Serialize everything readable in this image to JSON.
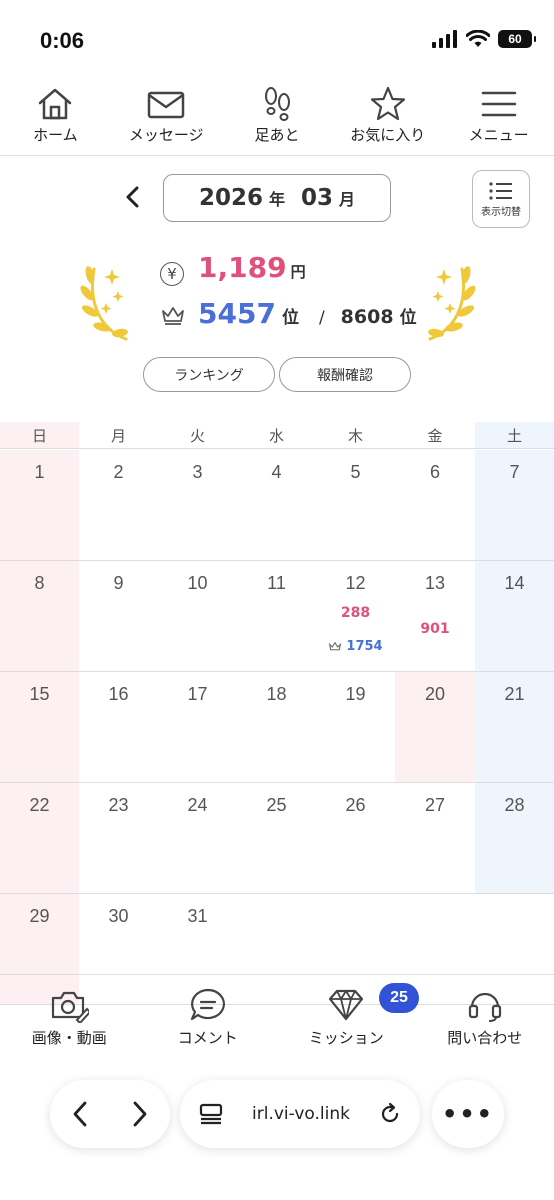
{
  "status": {
    "time": "0:06",
    "battery": "60"
  },
  "topnav": [
    {
      "label": "ホーム",
      "icon": "home-icon"
    },
    {
      "label": "メッセージ",
      "icon": "mail-icon"
    },
    {
      "label": "足あと",
      "icon": "footprints-icon"
    },
    {
      "label": "お気に入り",
      "icon": "star-icon"
    },
    {
      "label": "メニュー",
      "icon": "hamburger-icon"
    }
  ],
  "month": {
    "year": "2026",
    "year_unit": "年",
    "month": "03",
    "month_unit": "月",
    "view_toggle": "表示切替"
  },
  "stats": {
    "yen_symbol": "¥",
    "amount": "1,189",
    "amount_unit": "円",
    "rank": "5457",
    "rank_unit": "位",
    "slash": "/",
    "total": "8608",
    "total_unit": "位"
  },
  "buttons": {
    "ranking": "ランキング",
    "reward": "報酬確認"
  },
  "calendar": {
    "weekdays": [
      "日",
      "月",
      "火",
      "水",
      "木",
      "金",
      "土"
    ],
    "weeks": [
      [
        "1",
        "2",
        "3",
        "4",
        "5",
        "6",
        "7"
      ],
      [
        "8",
        "9",
        "10",
        "11",
        "12",
        "13",
        "14"
      ],
      [
        "15",
        "16",
        "17",
        "18",
        "19",
        "20",
        "21"
      ],
      [
        "22",
        "23",
        "24",
        "25",
        "26",
        "27",
        "28"
      ],
      [
        "29",
        "30",
        "31",
        "",
        "",
        "",
        ""
      ]
    ],
    "entries": {
      "12": {
        "earn": "288",
        "rank": "1754"
      },
      "13": {
        "earn": "901"
      }
    }
  },
  "tabbar": [
    {
      "label": "画像・動画",
      "icon": "camera-edit-icon"
    },
    {
      "label": "コメント",
      "icon": "comment-icon"
    },
    {
      "label": "ミッション",
      "icon": "diamond-icon",
      "badge": "25"
    },
    {
      "label": "問い合わせ",
      "icon": "headset-icon"
    }
  ],
  "browser": {
    "url": "irl.vi-vo.link",
    "more": "•••"
  },
  "colors": {
    "pink": "#e0507a",
    "blue": "#4a6fd8",
    "badge": "#3353d6",
    "sunday_bg": "#fdf0f2",
    "saturday_bg": "#eef5fc",
    "laurel": "#f0c93a"
  }
}
